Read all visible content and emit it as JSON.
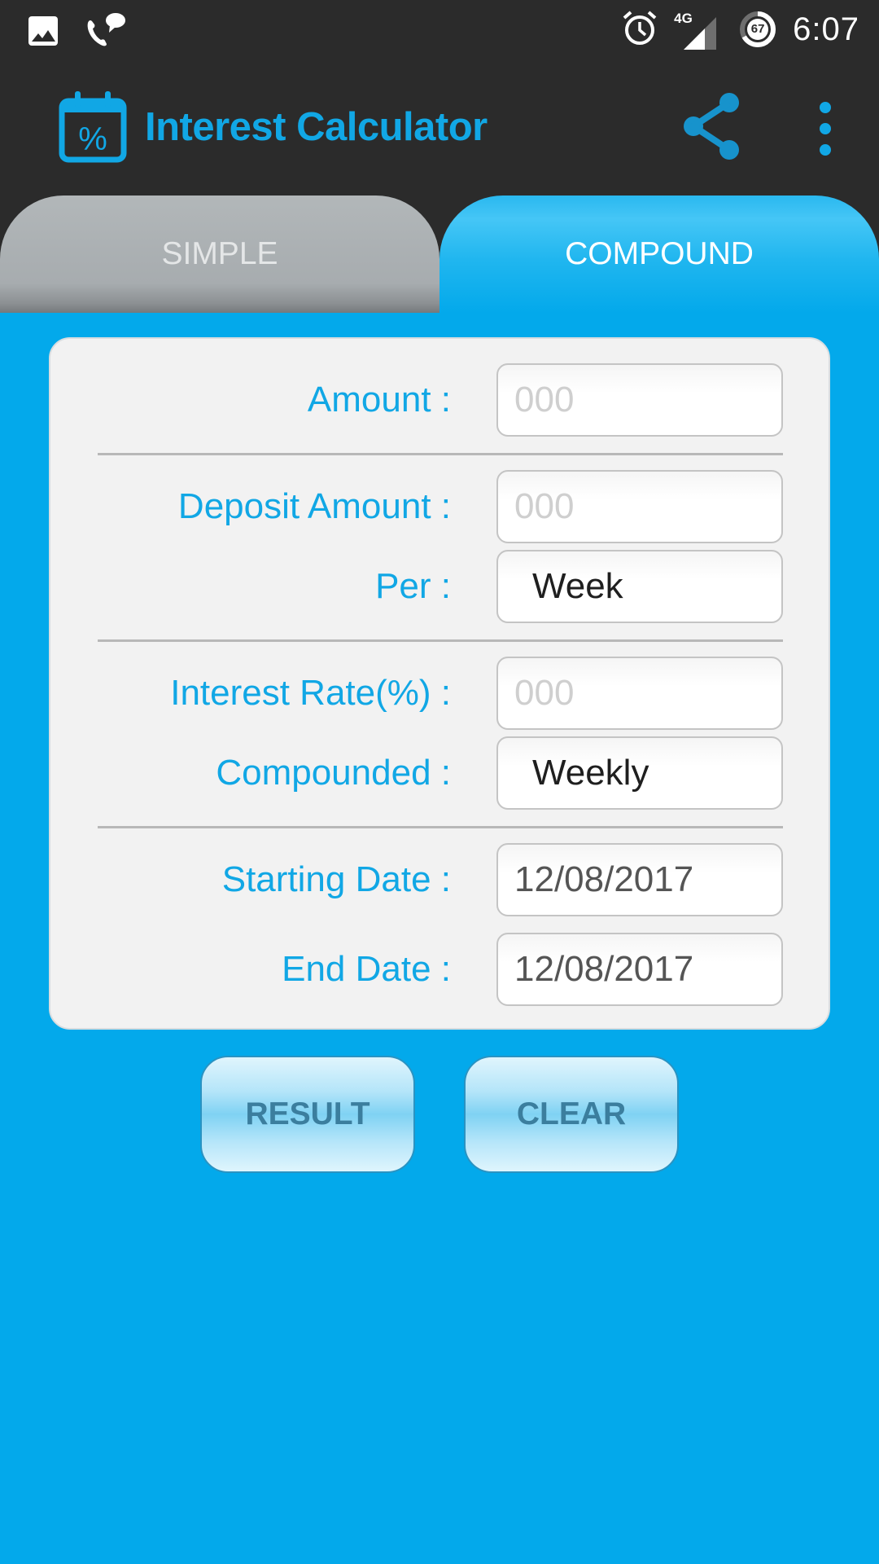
{
  "status_bar": {
    "left_icons": [
      "image-icon",
      "phone-message-icon"
    ],
    "right_icons": [
      "alarm-icon",
      "signal-4g-icon",
      "battery-icon"
    ],
    "network_label": "4G",
    "battery_level": "67",
    "time": "6:07"
  },
  "app_bar": {
    "title": "Interest Calculator",
    "logo_icon": "calendar-percent-icon",
    "actions": [
      "share-icon",
      "more-vert-icon"
    ]
  },
  "tabs": [
    {
      "label": "SIMPLE",
      "selected": false
    },
    {
      "label": "COMPOUND",
      "selected": true
    }
  ],
  "form": {
    "amount": {
      "label": "Amount :",
      "value": "",
      "placeholder": "000"
    },
    "deposit_amount": {
      "label": "Deposit Amount :",
      "value": "",
      "placeholder": "000"
    },
    "per": {
      "label": "Per :",
      "value": "Week"
    },
    "interest_rate": {
      "label": "Interest Rate(%) :",
      "value": "",
      "placeholder": "000"
    },
    "compounded": {
      "label": "Compounded :",
      "value": "Weekly"
    },
    "starting_date": {
      "label": "Starting Date :",
      "value": "12/08/2017"
    },
    "end_date": {
      "label": "End Date :",
      "value": "12/08/2017"
    }
  },
  "buttons": {
    "result": "RESULT",
    "clear": "CLEAR"
  },
  "colors": {
    "accent": "#11a7e5",
    "background": "#03a9eb",
    "bar": "#2b2b2b"
  }
}
